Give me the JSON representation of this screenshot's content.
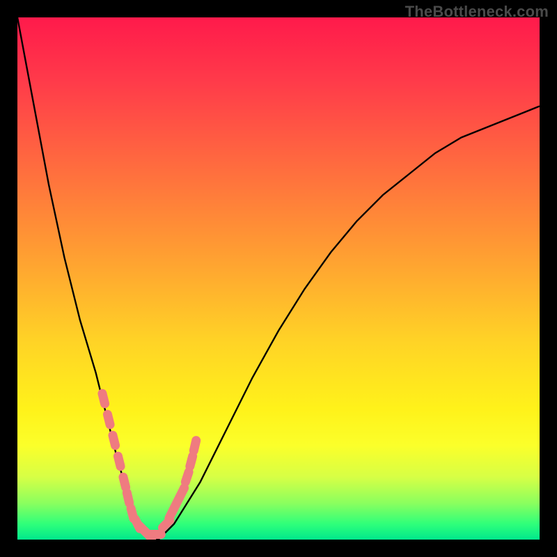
{
  "watermark": "TheBottleneck.com",
  "colors": {
    "frame": "#000000",
    "curve": "#000000",
    "marker_fill": "#ef7b80",
    "marker_stroke": "#e6646b"
  },
  "chart_data": {
    "type": "line",
    "title": "",
    "xlabel": "",
    "ylabel": "",
    "xlim": [
      0,
      100
    ],
    "ylim": [
      0,
      100
    ],
    "grid": false,
    "legend": false,
    "series": [
      {
        "name": "bottleneck-curve",
        "x": [
          0,
          3,
          6,
          9,
          12,
          15,
          17,
          19,
          21,
          23,
          25,
          27,
          30,
          35,
          40,
          45,
          50,
          55,
          60,
          65,
          70,
          75,
          80,
          85,
          90,
          95,
          100
        ],
        "y": [
          100,
          84,
          68,
          54,
          42,
          32,
          24,
          16,
          9,
          4,
          1,
          0,
          3,
          11,
          21,
          31,
          40,
          48,
          55,
          61,
          66,
          70,
          74,
          77,
          79,
          81,
          83
        ]
      }
    ],
    "markers": {
      "name": "highlighted-points",
      "x": [
        16.5,
        17.5,
        18.5,
        19.5,
        20.5,
        21.2,
        22.0,
        23.0,
        24.0,
        25.0,
        26.5,
        28.5,
        29.5,
        30.5,
        31.5,
        32.5,
        33.3,
        34.0
      ],
      "y": [
        27,
        23,
        19,
        15,
        11,
        8,
        5,
        3,
        2,
        1,
        1,
        3,
        5,
        7,
        9,
        12,
        15,
        18
      ]
    }
  }
}
